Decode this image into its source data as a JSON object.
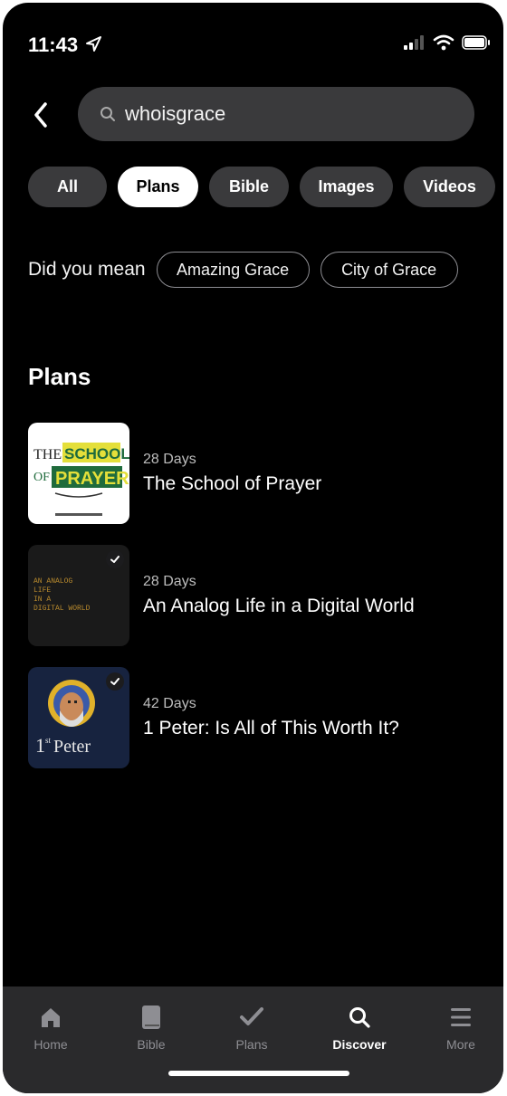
{
  "status": {
    "time": "11:43"
  },
  "search": {
    "query": "whoisgrace"
  },
  "filters": [
    {
      "label": "All",
      "active": false
    },
    {
      "label": "Plans",
      "active": true
    },
    {
      "label": "Bible",
      "active": false
    },
    {
      "label": "Images",
      "active": false
    },
    {
      "label": "Videos",
      "active": false
    }
  ],
  "did_you_mean": {
    "label": "Did you mean",
    "suggestions": [
      "Amazing Grace",
      "City of Grace"
    ]
  },
  "section": {
    "title": "Plans"
  },
  "plans": [
    {
      "days": "28 Days",
      "title": "The School of Prayer",
      "thumb": {
        "line1": "THE",
        "line2": "SCHOOL",
        "line3": "OF",
        "line4": "PRAYER"
      }
    },
    {
      "days": "28 Days",
      "title": "An Analog Life in a Digital World",
      "thumb": {
        "lines": [
          "AN ANALOG",
          "LIFE",
          "IN A",
          "DIGITAL WORLD"
        ]
      }
    },
    {
      "days": "42 Days",
      "title": "1 Peter: Is All of This Worth It?",
      "thumb": {
        "label_num": "1",
        "label_sup": "st",
        "label_word": "Peter"
      }
    }
  ],
  "tabs": [
    {
      "label": "Home",
      "icon": "home-icon",
      "active": false
    },
    {
      "label": "Bible",
      "icon": "book-icon",
      "active": false
    },
    {
      "label": "Plans",
      "icon": "checkmark-icon",
      "active": false
    },
    {
      "label": "Discover",
      "icon": "search-icon",
      "active": true
    },
    {
      "label": "More",
      "icon": "menu-icon",
      "active": false
    }
  ],
  "colors": {
    "background": "#000000",
    "chip": "#3a3a3c",
    "tabbar": "#2a2a2c",
    "active_text": "#ffffff",
    "inactive_text": "#8e8e93"
  }
}
